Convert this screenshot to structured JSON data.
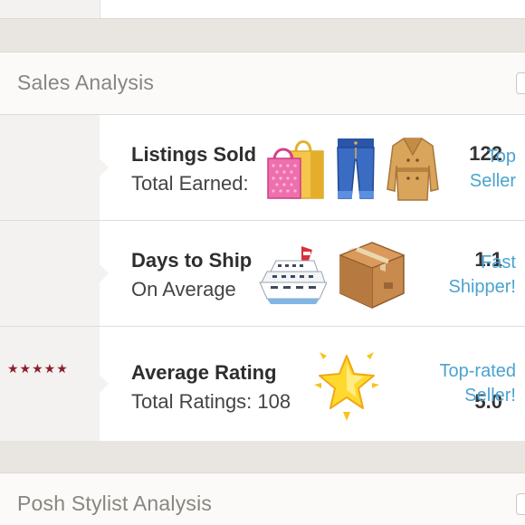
{
  "sales_analysis": {
    "title": "Sales Analysis"
  },
  "stats": [
    {
      "value": "122",
      "label": "Listings Sold",
      "sublabel": "Total Earned:",
      "badge_line1": "Top",
      "badge_line2": "Seller",
      "icons": [
        "shopping-bags-icon",
        "jeans-icon",
        "coat-icon"
      ]
    },
    {
      "value": "1.1",
      "label": "Days to Ship",
      "sublabel": "On Average",
      "badge_line1": "Fast",
      "badge_line2": "Shipper!",
      "icons": [
        "cruise-ship-icon",
        "package-icon"
      ]
    },
    {
      "value": "5.0",
      "stars": "★★★★★",
      "rating": 5,
      "label": "Average Rating",
      "sublabel": "Total Ratings: 108",
      "badge_line1": "Top-rated",
      "badge_line2": "Seller!",
      "icons": [
        "glowing-star-icon"
      ]
    }
  ],
  "posh_stylist_analysis": {
    "title": "Posh Stylist Analysis"
  },
  "colors": {
    "badge": "#4aa3cf",
    "stars": "#8b1e2d",
    "background": "#e9e6e2"
  }
}
